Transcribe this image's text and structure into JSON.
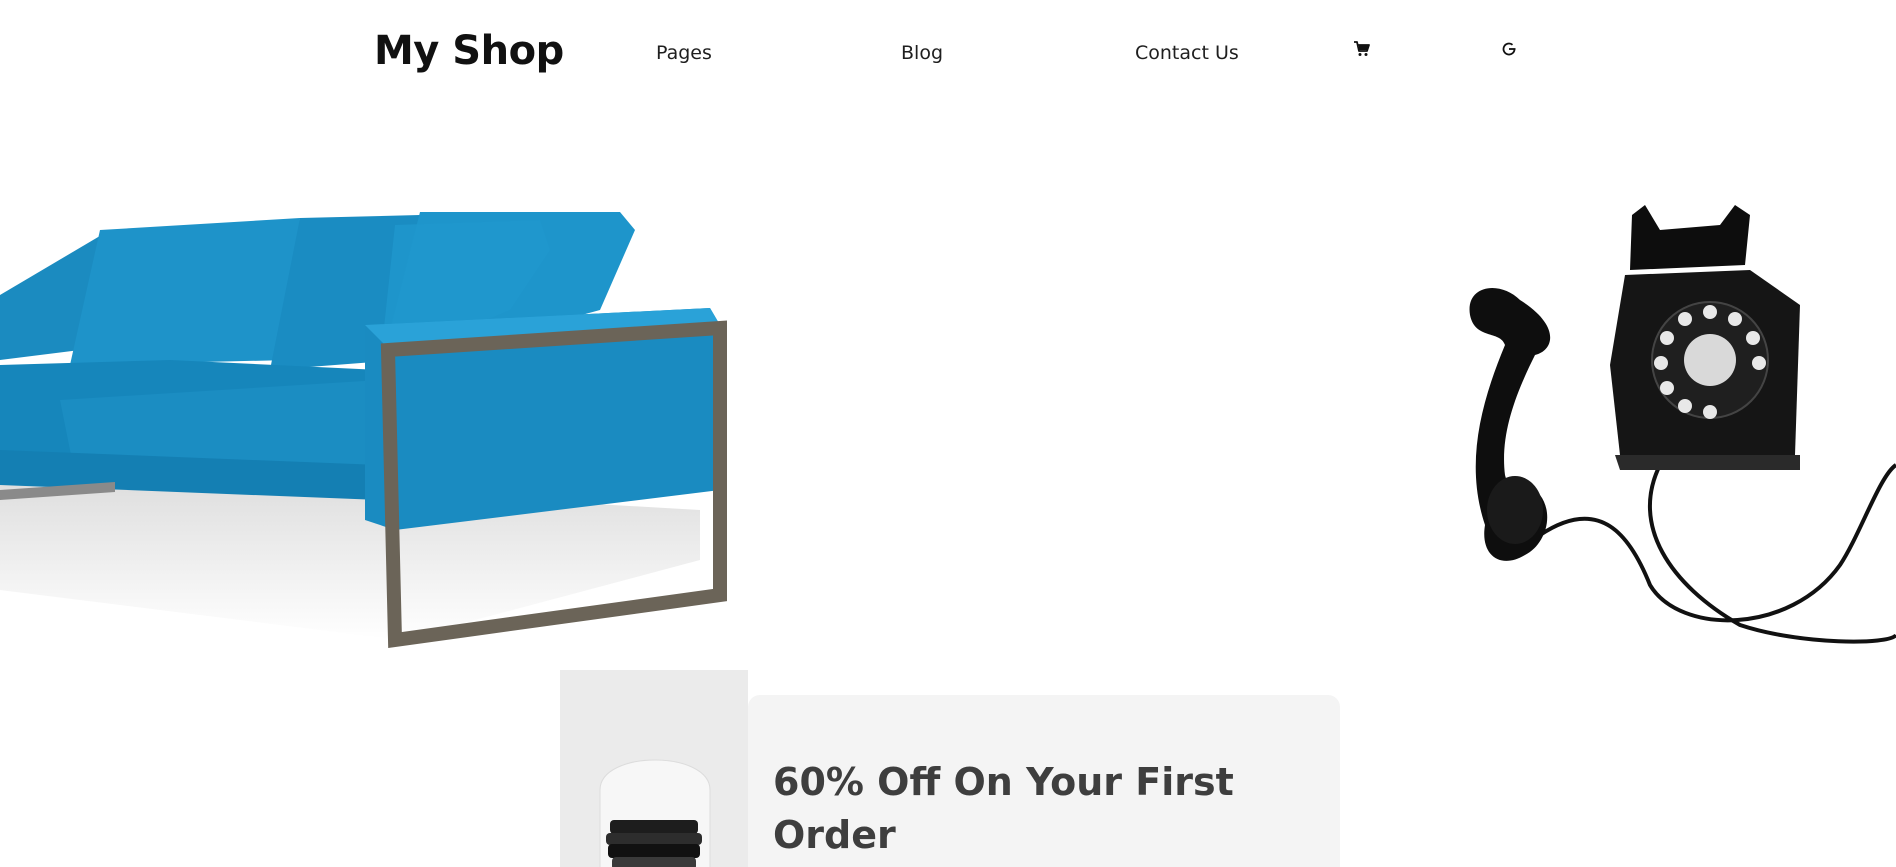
{
  "header": {
    "logo": "My Shop",
    "nav": {
      "pages": "Pages",
      "blog": "Blog",
      "contact": "Contact Us"
    },
    "icons": [
      "cart-icon",
      "refresh-icon"
    ]
  },
  "promo": {
    "title": "60% Off On Your First Order"
  },
  "colors": {
    "sofa_blue": "#1e8fc4",
    "text_dark": "#111111",
    "promo_text": "#3e3e3e",
    "promo_bg": "#f4f4f4"
  }
}
